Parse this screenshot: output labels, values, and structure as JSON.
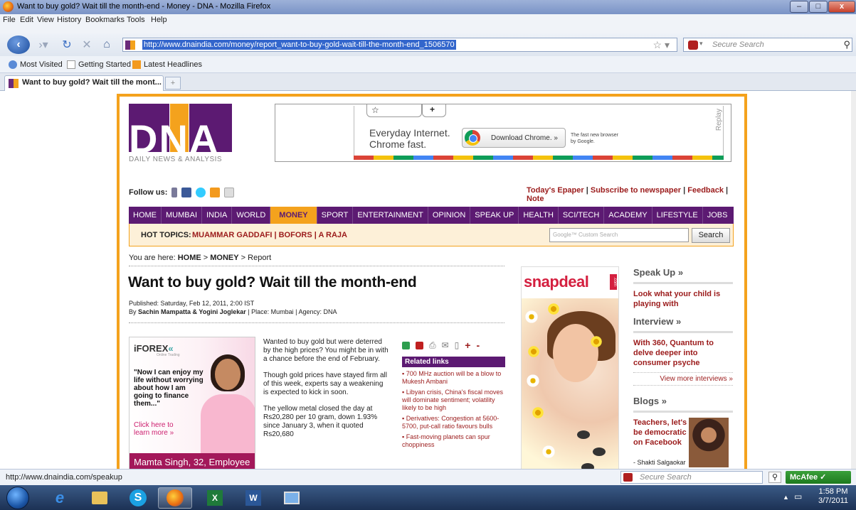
{
  "window": {
    "title": "Want to buy gold? Wait till the month-end - Money - DNA - Mozilla Firefox"
  },
  "menu": [
    "File",
    "Edit",
    "View",
    "History",
    "Bookmarks",
    "Tools",
    "Help"
  ],
  "nav": {
    "url": "http://www.dnaindia.com/money/report_want-to-buy-gold-wait-till-the-month-end_1506570",
    "search_placeholder": "Secure Search"
  },
  "bookmarks": [
    "Most Visited",
    "Getting Started",
    "Latest Headlines"
  ],
  "tabs": [
    {
      "label": "Want to buy gold? Wait till the mont..."
    }
  ],
  "logo": {
    "letters": "DNA",
    "subtitle": "DAILY NEWS & ANALYSIS"
  },
  "ad_chrome": {
    "tagline1": "Everyday Internet.",
    "tagline2": "Chrome fast.",
    "button": "Download Chrome. »",
    "small1": "The fast new browser",
    "small2": "by Google.",
    "replay": "Replay"
  },
  "follow_label": "Follow us:",
  "top_links": [
    "Today's Epaper",
    "Subscribe to newspaper",
    "Feedback",
    "Note"
  ],
  "main_nav": [
    "HOME",
    "MUMBAI",
    "INDIA",
    "WORLD",
    "MONEY",
    "SPORT",
    "ENTERTAINMENT",
    "OPINION",
    "SPEAK UP",
    "HEALTH",
    "SCI/TECH",
    "ACADEMY",
    "LIFESTYLE",
    "JOBS"
  ],
  "active_nav": "MONEY",
  "hot_topics": {
    "label": "HOT TOPICS:",
    "items": "MUAMMAR GADDAFI | BOFORS | A RAJA"
  },
  "site_search": {
    "placeholder": "Google™ Custom Search",
    "button": "Search"
  },
  "breadcrumb": {
    "prefix": "You are here:",
    "home": "HOME",
    "section": "MONEY",
    "page": "Report"
  },
  "article": {
    "headline": "Want to buy gold? Wait till the month-end",
    "published": "Published: Saturday, Feb 12, 2011, 2:00 IST",
    "byline_prefix": "By",
    "authors": "Sachin Mampatta & Yogini Joglekar",
    "byline_rest": "| Place: Mumbai | Agency: DNA",
    "paragraphs": [
      "Wanted to buy gold but were deterred by the high prices? You might be in with a chance before the end of February.",
      "Though gold prices have stayed firm all of this week, experts say a weakening is expected to kick in soon.",
      "The yellow metal closed the day at Rs20,280 per 10 gram, down 1.93% since January 3, when it quoted Rs20,680"
    ]
  },
  "forex_ad": {
    "logo": "iFOREX",
    "sub": "Online Trading",
    "quote": "\"Now I can enjoy my life without worrying about how I am going to finance them...\"",
    "click": "Click here to learn more »",
    "caption": "Mamta Singh, 32, Employee"
  },
  "related": {
    "title": "Related links",
    "links": [
      "700 MHz auction will be a blow to Mukesh Ambani",
      "Libyan crisis, China's fiscal moves will dominate sentiment; volatility likely to be high",
      "Derivatives: Congestion at 5600-5700, put-call ratio favours bulls",
      "Fast-moving planets can spur choppiness"
    ]
  },
  "snapdeal": {
    "logo": "snapdeal",
    "com": ".com"
  },
  "right_col": {
    "speakup_title": "Speak Up »",
    "speakup_link": "Look what your child is playing with",
    "interview_title": "Interview »",
    "interview_link": "With 360, Quantum to delve deeper into consumer psyche",
    "interview_more": "View more interviews »",
    "blogs_title": "Blogs »",
    "blogs_link": "Teachers, let's be democratic on Facebook",
    "blogs_author": "- Shakti Salgaokar"
  },
  "status": {
    "text": "http://www.dnaindia.com/speakup",
    "search": "Secure Search",
    "mcafee": "McAfee"
  },
  "clock": {
    "time": "1:58 PM",
    "date": "3/7/2011"
  },
  "colors": {
    "dna_purple": "#5c1a72",
    "dna_orange": "#f4a21d",
    "link_red": "#9b1b1b"
  }
}
